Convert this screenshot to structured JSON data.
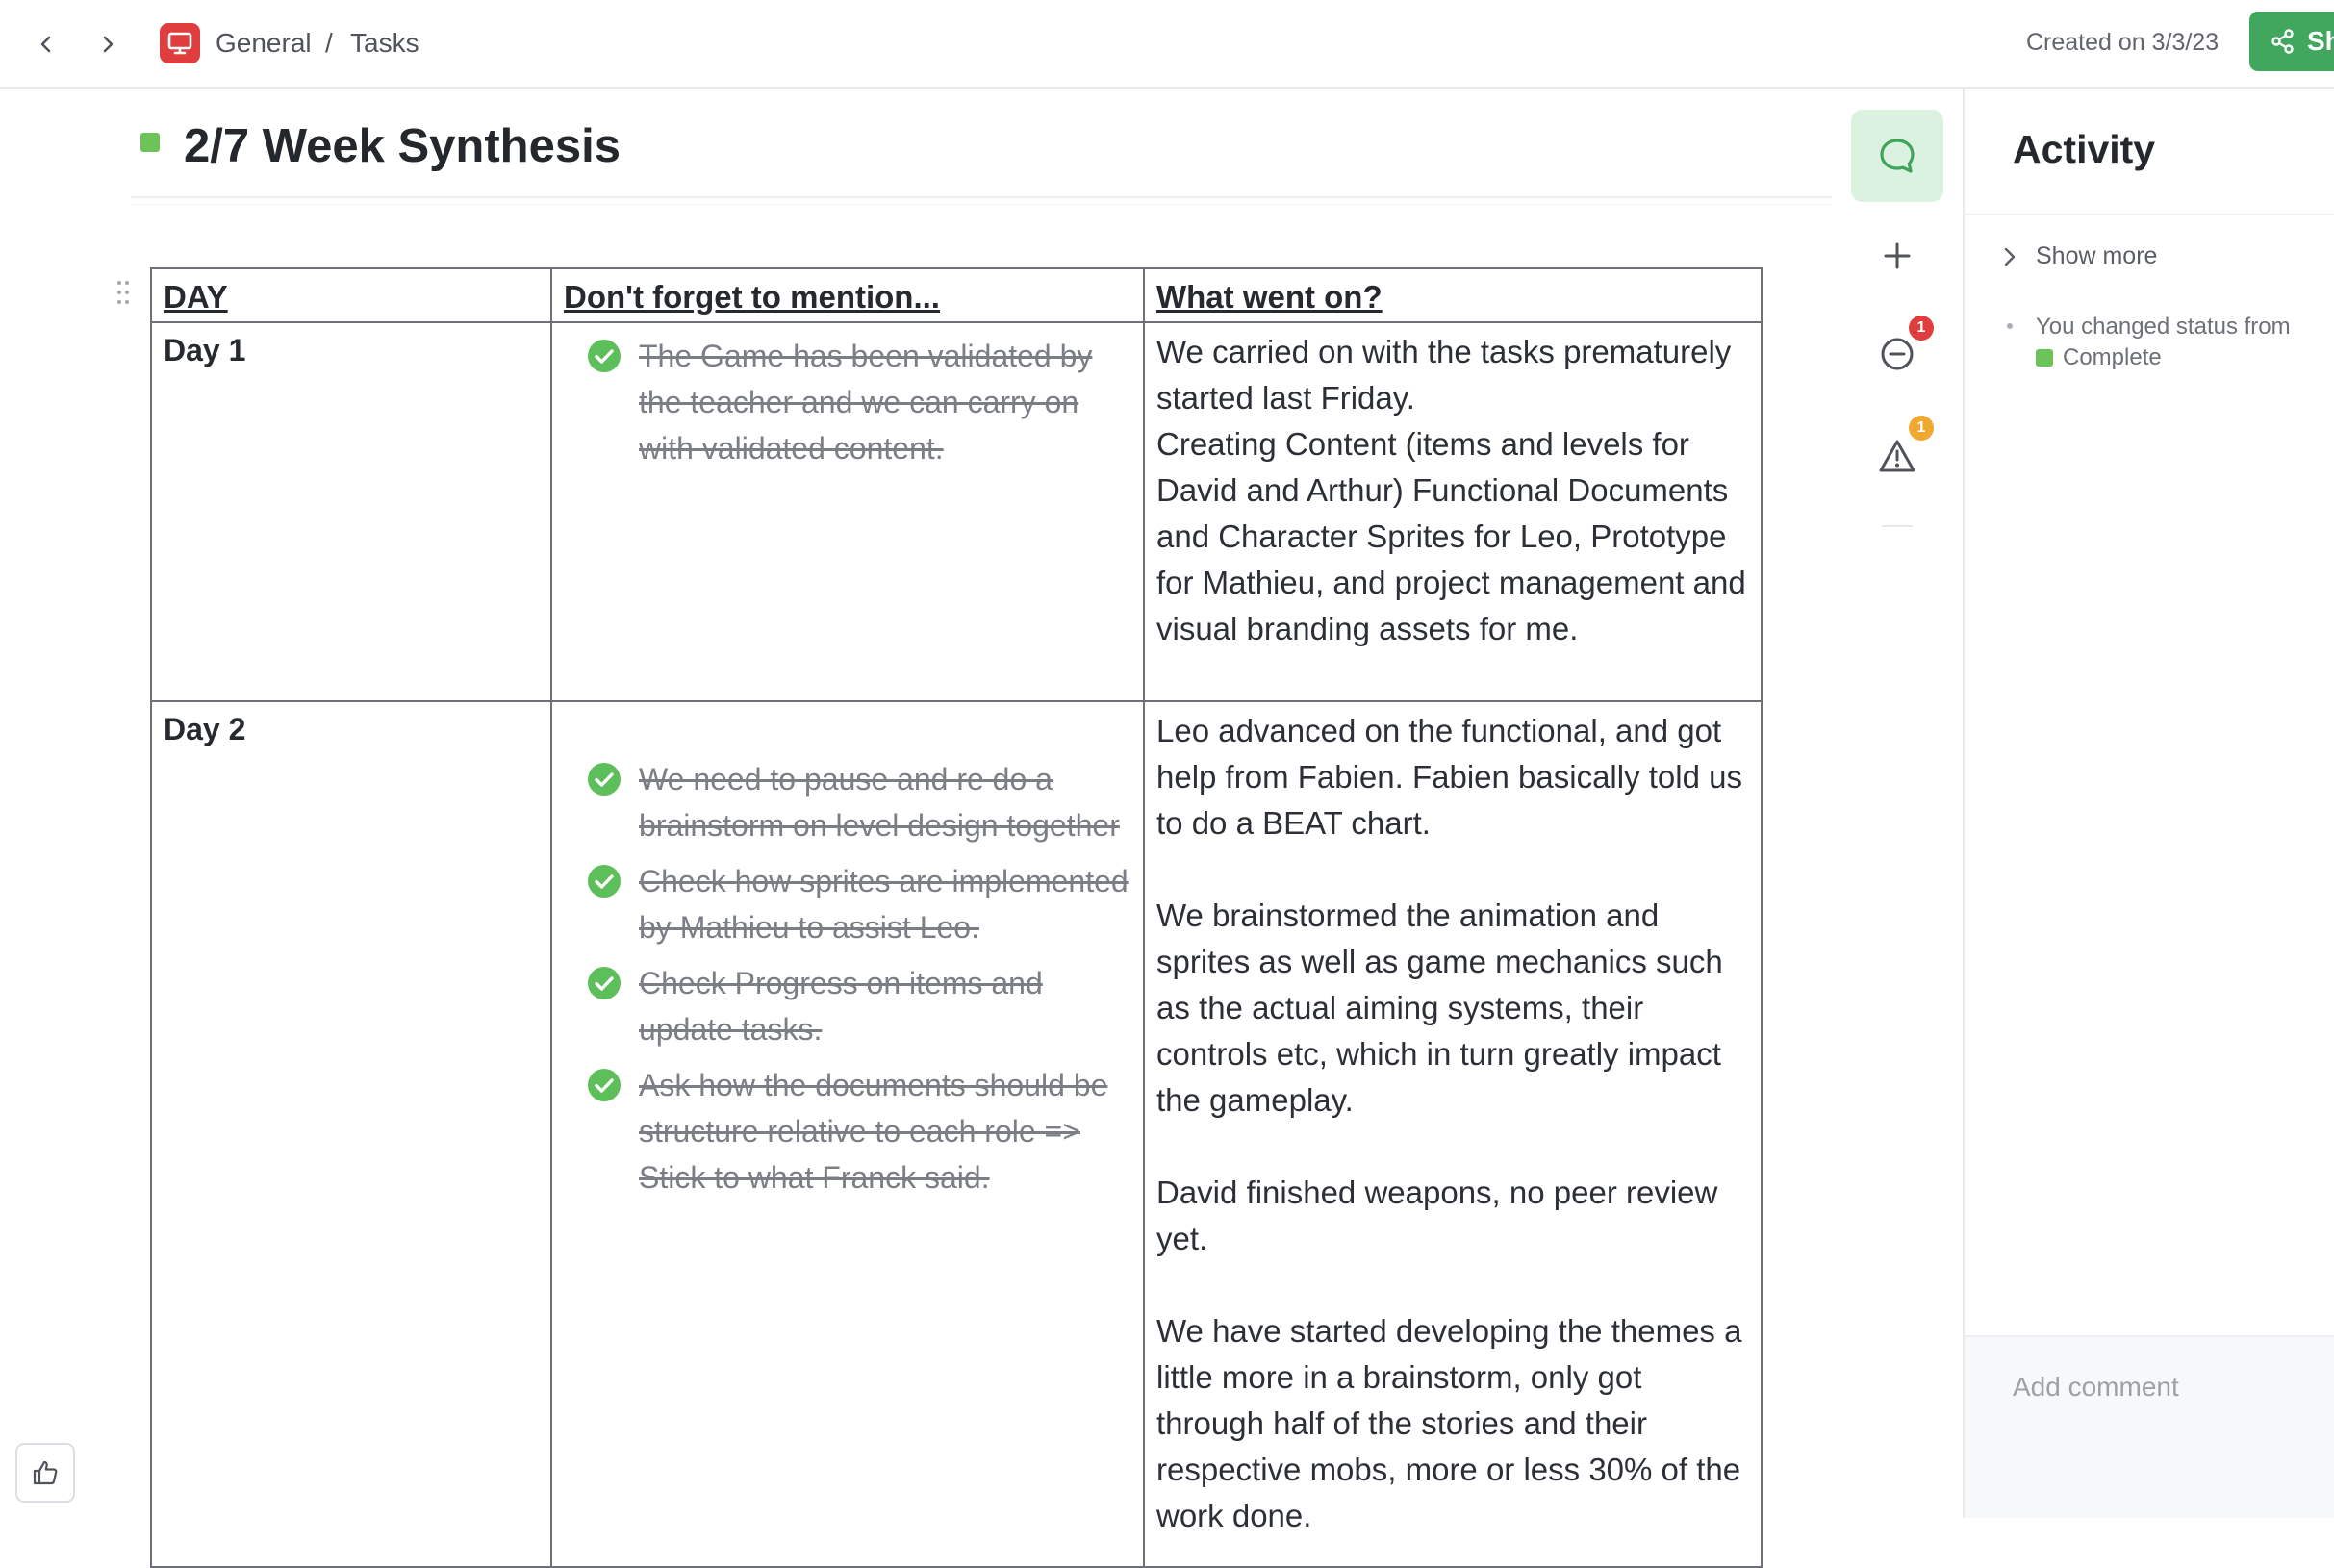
{
  "breadcrumb": {
    "space": "General",
    "separator": "/",
    "page": "Tasks"
  },
  "header": {
    "created": "Created on 3/3/23",
    "share_label": "Sh"
  },
  "doc": {
    "title": "2/7 Week Synthesis",
    "title_marker_color": "#6bc35a"
  },
  "table": {
    "headers": [
      "DAY",
      "Don't forget to mention...",
      "What went on?"
    ],
    "rows": [
      {
        "day": "Day 1",
        "todos": [
          "The Game has been validated by the teacher and we can carry on with validated content."
        ],
        "notes": [
          "We carried on with the tasks prematurely started last Friday.",
          "Creating Content (items and levels for David and Arthur) Functional Documents and Character Sprites for Leo, Prototype for Mathieu, and project management and visual branding assets for me."
        ]
      },
      {
        "day": "Day 2",
        "todos": [
          "We need to pause and re do a brainstorm on level design together",
          "Check how sprites are implemented by Mathieu to assist Leo.",
          "Check Progress on items and update tasks.",
          "Ask how the documents should be structure relative to each role => Stick to what Franck said."
        ],
        "notes": [
          "Leo advanced on the functional, and got help from Fabien. Fabien basically told us to do a BEAT chart.",
          "We brainstormed the animation and sprites as well as game mechanics such as the actual aiming systems, their controls etc, which in turn greatly impact the gameplay.",
          "David finished weapons, no peer review yet.",
          "We have started developing the themes a little more in a brainstorm, only got through half of the stories and their respective mobs, more or less 30% of the work done."
        ]
      }
    ]
  },
  "rail": {
    "badge_1": "1",
    "badge_2": "1"
  },
  "activity": {
    "title": "Activity",
    "show_more": "Show more",
    "item_text": "You changed status from",
    "item_status": "Complete",
    "add_comment_placeholder": "Add comment"
  },
  "colors": {
    "accent_green": "#41a65e",
    "check_green": "#5cbf5a",
    "badge_red": "#e03e3e",
    "badge_orange": "#f0a830"
  }
}
